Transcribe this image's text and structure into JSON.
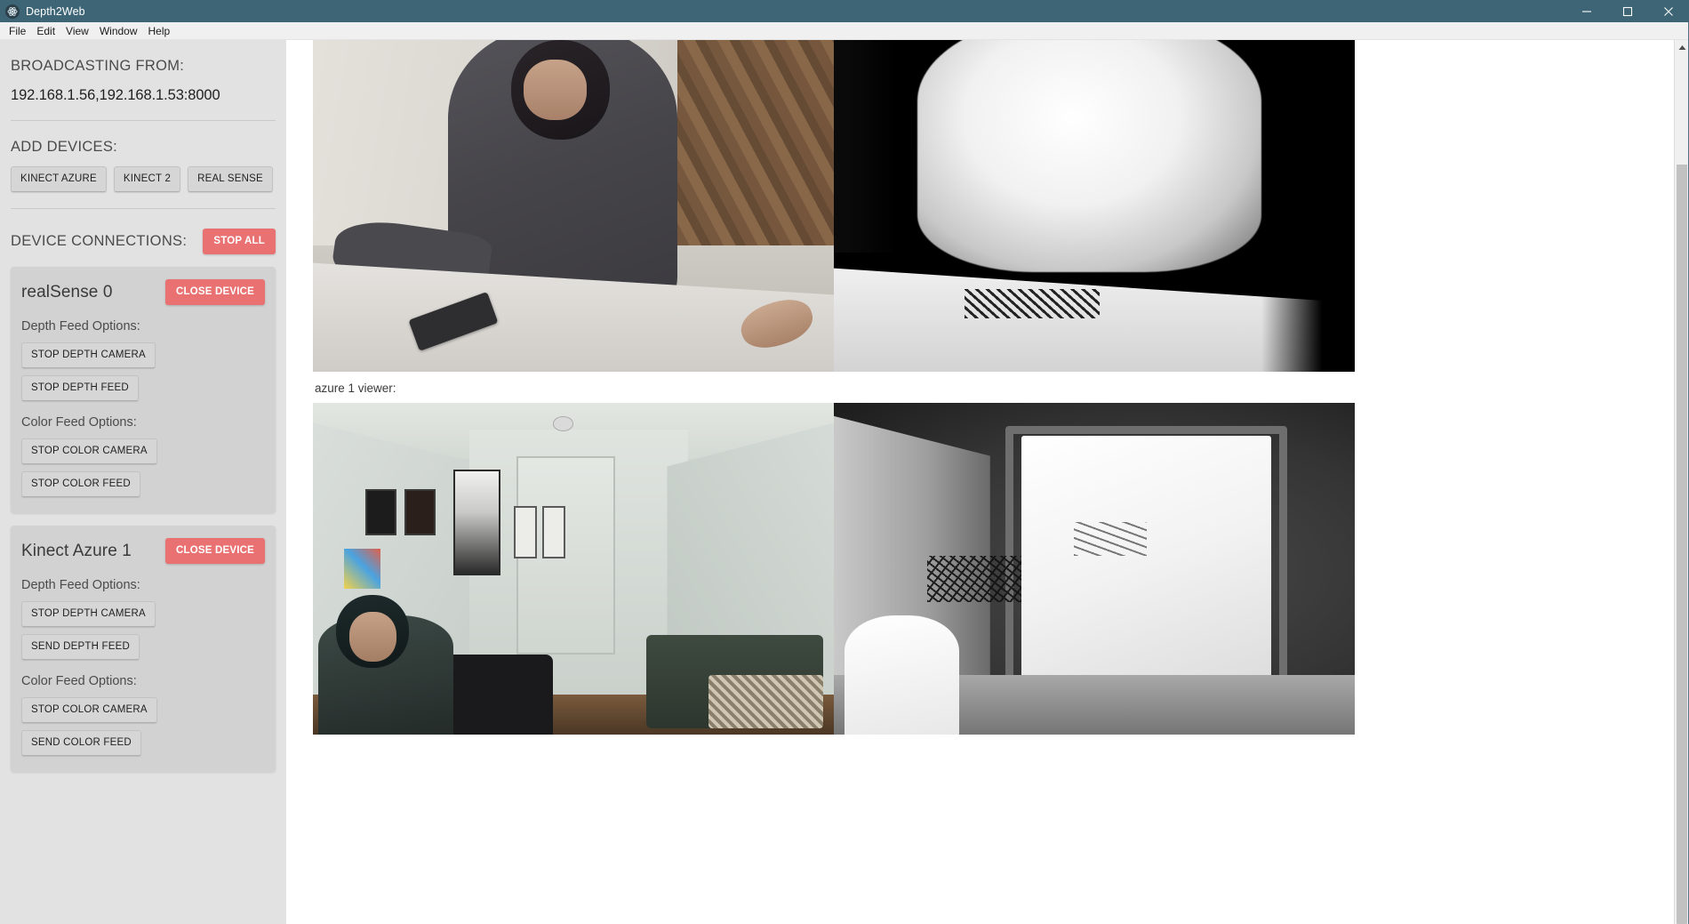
{
  "window": {
    "title": "Depth2Web",
    "app_icon": "app-logo-icon",
    "controls": {
      "minimize": "minimize-icon",
      "maximize": "maximize-icon",
      "close": "close-icon"
    },
    "titlebar_color": "#3d6576"
  },
  "menubar": {
    "items": [
      "File",
      "Edit",
      "View",
      "Window",
      "Help"
    ]
  },
  "sidebar": {
    "broadcasting": {
      "label": "BROADCASTING FROM:",
      "value": "192.168.1.56,192.168.1.53:8000"
    },
    "add_devices": {
      "label": "ADD DEVICES:",
      "buttons": [
        "KINECT AZURE",
        "KINECT 2",
        "REAL SENSE"
      ]
    },
    "device_connections": {
      "label": "DEVICE CONNECTIONS:",
      "stop_all_label": "STOP ALL",
      "accent_red": "#ea7171",
      "devices": [
        {
          "name": "realSense 0",
          "close_label": "CLOSE DEVICE",
          "depth_label": "Depth Feed Options:",
          "depth_buttons": [
            "STOP DEPTH CAMERA",
            "STOP DEPTH FEED"
          ],
          "color_label": "Color Feed Options:",
          "color_buttons": [
            "STOP COLOR CAMERA",
            "STOP COLOR FEED"
          ]
        },
        {
          "name": "Kinect Azure 1",
          "close_label": "CLOSE DEVICE",
          "depth_label": "Depth Feed Options:",
          "depth_buttons": [
            "STOP DEPTH CAMERA",
            "SEND DEPTH FEED"
          ],
          "color_label": "Color Feed Options:",
          "color_buttons": [
            "STOP COLOR CAMERA",
            "SEND COLOR FEED"
          ]
        }
      ]
    }
  },
  "main": {
    "viewers": [
      {
        "caption": "",
        "color_feed_name": "realsense-color-feed",
        "depth_feed_name": "realsense-depth-feed"
      },
      {
        "caption": "azure 1 viewer:",
        "color_feed_name": "azure-color-feed",
        "depth_feed_name": "azure-depth-feed"
      }
    ]
  },
  "scrollbar": {
    "up_arrow": "scroll-up-arrow-icon"
  }
}
